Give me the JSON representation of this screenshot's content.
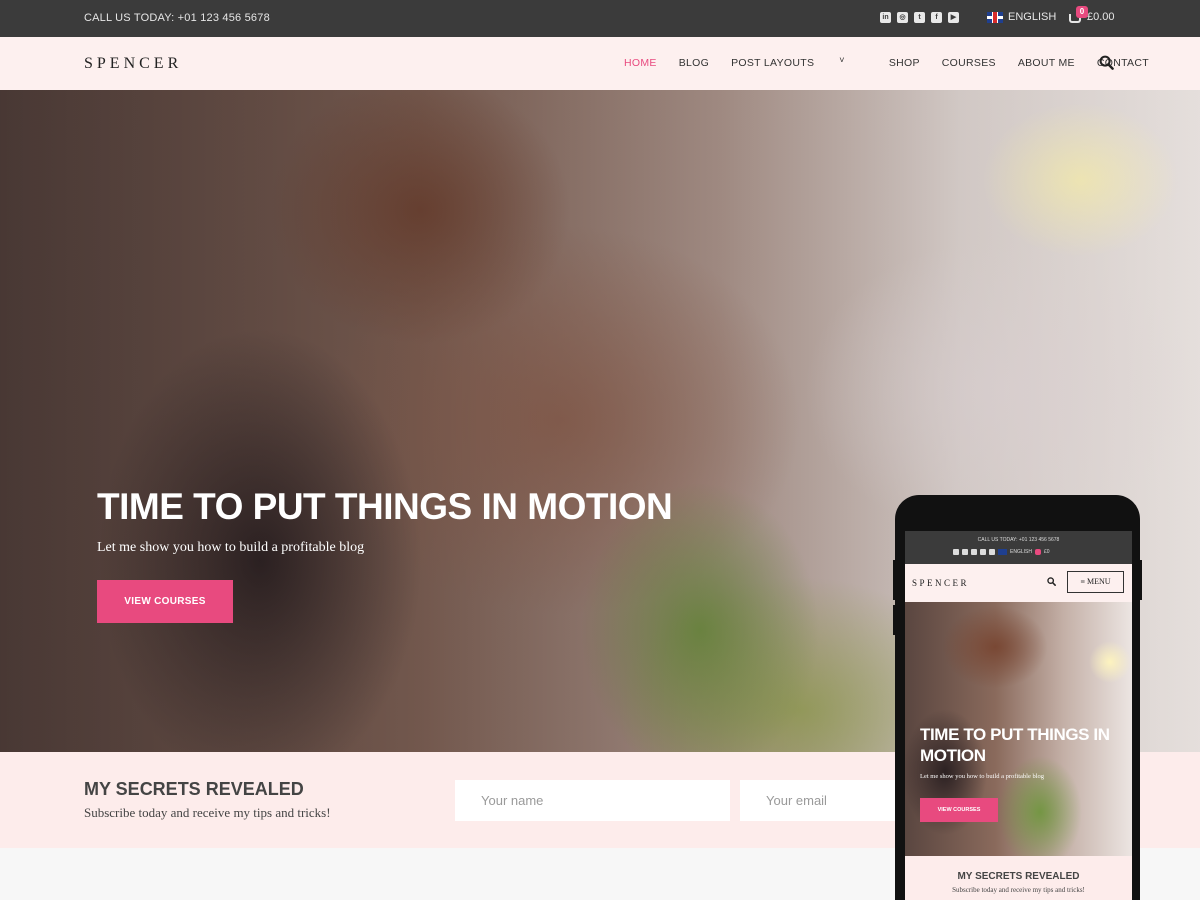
{
  "topbar": {
    "phone_text": "CALL US TODAY: +01 123 456 5678",
    "socials": [
      {
        "icon": "linkedin-icon",
        "glyph": "in"
      },
      {
        "icon": "instagram-icon",
        "glyph": "◎"
      },
      {
        "icon": "twitter-icon",
        "glyph": "t"
      },
      {
        "icon": "facebook-icon",
        "glyph": "f"
      },
      {
        "icon": "youtube-icon",
        "glyph": "▶"
      }
    ],
    "language": "ENGLISH",
    "cart_count": "0",
    "cart_total": "£0.00"
  },
  "header": {
    "logo": "SPENCER",
    "nav": [
      "HOME",
      "BLOG",
      "POST LAYOUTS",
      "SHOP",
      "COURSES",
      "ABOUT ME",
      "CONTACT"
    ],
    "dropdown_chevron": "˅"
  },
  "hero": {
    "title": "TIME TO PUT THINGS IN MOTION",
    "subtitle": "Let me show you how to build a profitable blog",
    "button": "VIEW COURSES"
  },
  "newsletter": {
    "title": "MY SECRETS REVEALED",
    "subtitle": "Subscribe today and receive my tips and tricks!",
    "name_placeholder": "Your name",
    "email_placeholder": "Your email"
  },
  "mobile": {
    "phone_text": "CALL US TODAY: +01 123 456 5678",
    "language": "ENGLISH",
    "cart_total": "£0",
    "logo": "SPENCER",
    "menu_label": "≡ MENU",
    "hero_title": "TIME TO PUT THINGS IN MOTION",
    "hero_subtitle": "Let me show you how to build a profitable blog",
    "hero_button": "VIEW COURSES",
    "news_title": "MY SECRETS REVEALED",
    "news_subtitle": "Subscribe today and receive my tips and tricks!"
  },
  "colors": {
    "accent": "#e84a7f",
    "topbar_bg": "#3b3b3b",
    "header_bg": "#fdf0ef",
    "newsletter_bg": "#fdeceb"
  }
}
